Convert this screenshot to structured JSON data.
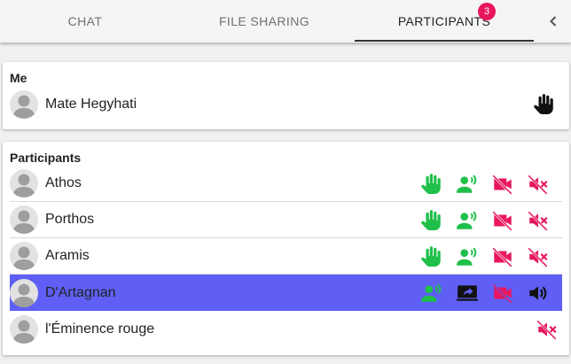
{
  "tabs": {
    "chat": "CHAT",
    "file_sharing": "FILE SHARING",
    "participants": "PARTICIPANTS",
    "participants_badge": "3"
  },
  "me": {
    "section_title": "Me",
    "name": "Mate Hegyhati",
    "icons": [
      "raised-hand-icon"
    ]
  },
  "participants": {
    "section_title": "Participants",
    "rows": [
      {
        "name": "Athos",
        "icons": [
          "raised-hand-icon",
          "speaker-request-icon",
          "video-off-icon",
          "muted-icon"
        ],
        "selected": false
      },
      {
        "name": "Porthos",
        "icons": [
          "raised-hand-icon",
          "speaker-request-icon",
          "video-off-icon",
          "muted-icon"
        ],
        "selected": false
      },
      {
        "name": "Aramis",
        "icons": [
          "raised-hand-icon",
          "speaker-request-icon",
          "video-off-icon",
          "muted-icon"
        ],
        "selected": false
      },
      {
        "name": "D'Artagnan",
        "icons": [
          "speaker-request-icon",
          "screen-share-icon",
          "video-off-icon",
          "volume-icon"
        ],
        "selected": true
      },
      {
        "name": "l'Éminence rouge",
        "icons": [
          "muted-icon"
        ],
        "selected": false
      }
    ]
  },
  "colors": {
    "accent_green": "#1fbf4a",
    "accent_red": "#e8175d",
    "selected_row": "#5f5ff5",
    "badge": "#e8175d"
  }
}
